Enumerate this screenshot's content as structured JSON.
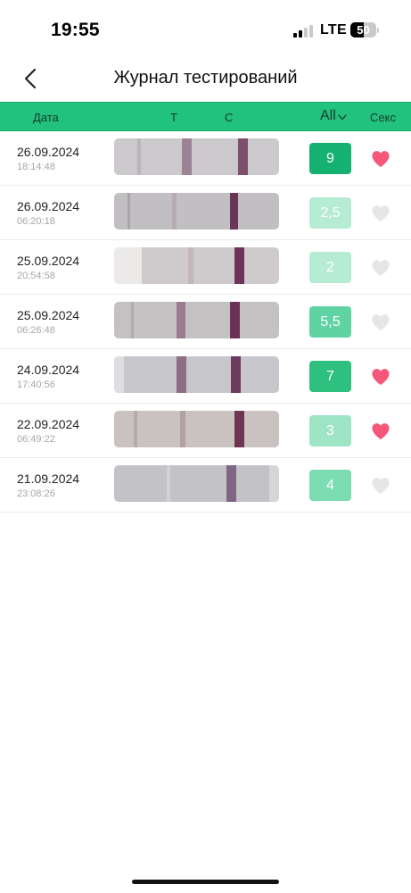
{
  "status_bar": {
    "time": "19:55",
    "network": "LTE",
    "battery": "50",
    "battery_level": 0.5
  },
  "header": {
    "title": "Журнал тестирований"
  },
  "columns": {
    "date": "Дата",
    "t": "T",
    "c": "C",
    "filter": "All",
    "sex": "Секс"
  },
  "colors": {
    "accent": "#21c17e",
    "heart_active": "#f5577a",
    "heart_inactive": "#e6e6e6"
  },
  "rows": [
    {
      "date": "26.09.2024",
      "time": "18:14:48",
      "score": "9",
      "score_color": "#15b170",
      "sex": true,
      "strip": {
        "bg": "#cbc9cc",
        "bands": [
          {
            "pos": 0.14,
            "w": 0.02,
            "color": "#b9b6b9"
          },
          {
            "pos": 0.41,
            "w": 0.06,
            "color": "#9c8495"
          },
          {
            "pos": 0.75,
            "w": 0.06,
            "color": "#7e4e6d"
          }
        ]
      }
    },
    {
      "date": "26.09.2024",
      "time": "06:20:18",
      "score": "2,5",
      "score_color": "#b6ebd4",
      "sex": false,
      "strip": {
        "bg": "#c2bfc2",
        "bands": [
          {
            "pos": 0.08,
            "w": 0.02,
            "color": "#a9a6a9"
          },
          {
            "pos": 0.35,
            "w": 0.03,
            "color": "#b7acb3"
          },
          {
            "pos": 0.7,
            "w": 0.05,
            "color": "#6b3557"
          }
        ]
      }
    },
    {
      "date": "25.09.2024",
      "time": "20:54:58",
      "score": "2",
      "score_color": "#b6ebd4",
      "sex": false,
      "strip": {
        "bg": "#cfcbcd",
        "bands": [
          {
            "pos": 0.0,
            "w": 0.17,
            "color": "#ebeae9"
          },
          {
            "pos": 0.45,
            "w": 0.03,
            "color": "#c5b5bf"
          },
          {
            "pos": 0.73,
            "w": 0.06,
            "color": "#6e3357"
          }
        ]
      }
    },
    {
      "date": "25.09.2024",
      "time": "06:26:48",
      "score": "5,5",
      "score_color": "#5fd3a2",
      "sex": false,
      "strip": {
        "bg": "#c4c1c3",
        "bands": [
          {
            "pos": 0.1,
            "w": 0.02,
            "color": "#aeabad"
          },
          {
            "pos": 0.38,
            "w": 0.05,
            "color": "#9b7b8f"
          },
          {
            "pos": 0.7,
            "w": 0.06,
            "color": "#6a3355"
          }
        ]
      }
    },
    {
      "date": "24.09.2024",
      "time": "17:40:56",
      "score": "7",
      "score_color": "#2ec07f",
      "sex": true,
      "strip": {
        "bg": "#c7c7cb",
        "bands": [
          {
            "pos": 0.0,
            "w": 0.06,
            "color": "#dedde0"
          },
          {
            "pos": 0.38,
            "w": 0.06,
            "color": "#8f6d84"
          },
          {
            "pos": 0.71,
            "w": 0.06,
            "color": "#6c3a5d"
          }
        ]
      }
    },
    {
      "date": "22.09.2024",
      "time": "06:49:22",
      "score": "3",
      "score_color": "#9de5c4",
      "sex": true,
      "strip": {
        "bg": "#c9c2c1",
        "bands": [
          {
            "pos": 0.12,
            "w": 0.02,
            "color": "#b3acab"
          },
          {
            "pos": 0.4,
            "w": 0.03,
            "color": "#b3a0a6"
          },
          {
            "pos": 0.73,
            "w": 0.06,
            "color": "#6e3552"
          }
        ]
      }
    },
    {
      "date": "21.09.2024",
      "time": "23:08:26",
      "score": "4",
      "score_color": "#7cdcb2",
      "sex": false,
      "strip": {
        "bg": "#c3c2c7",
        "bands": [
          {
            "pos": 0.32,
            "w": 0.02,
            "color": "#d2d1d6"
          },
          {
            "pos": 0.68,
            "w": 0.06,
            "color": "#7f6684"
          },
          {
            "pos": 0.94,
            "w": 0.06,
            "color": "#d6d6d4"
          }
        ]
      }
    }
  ]
}
